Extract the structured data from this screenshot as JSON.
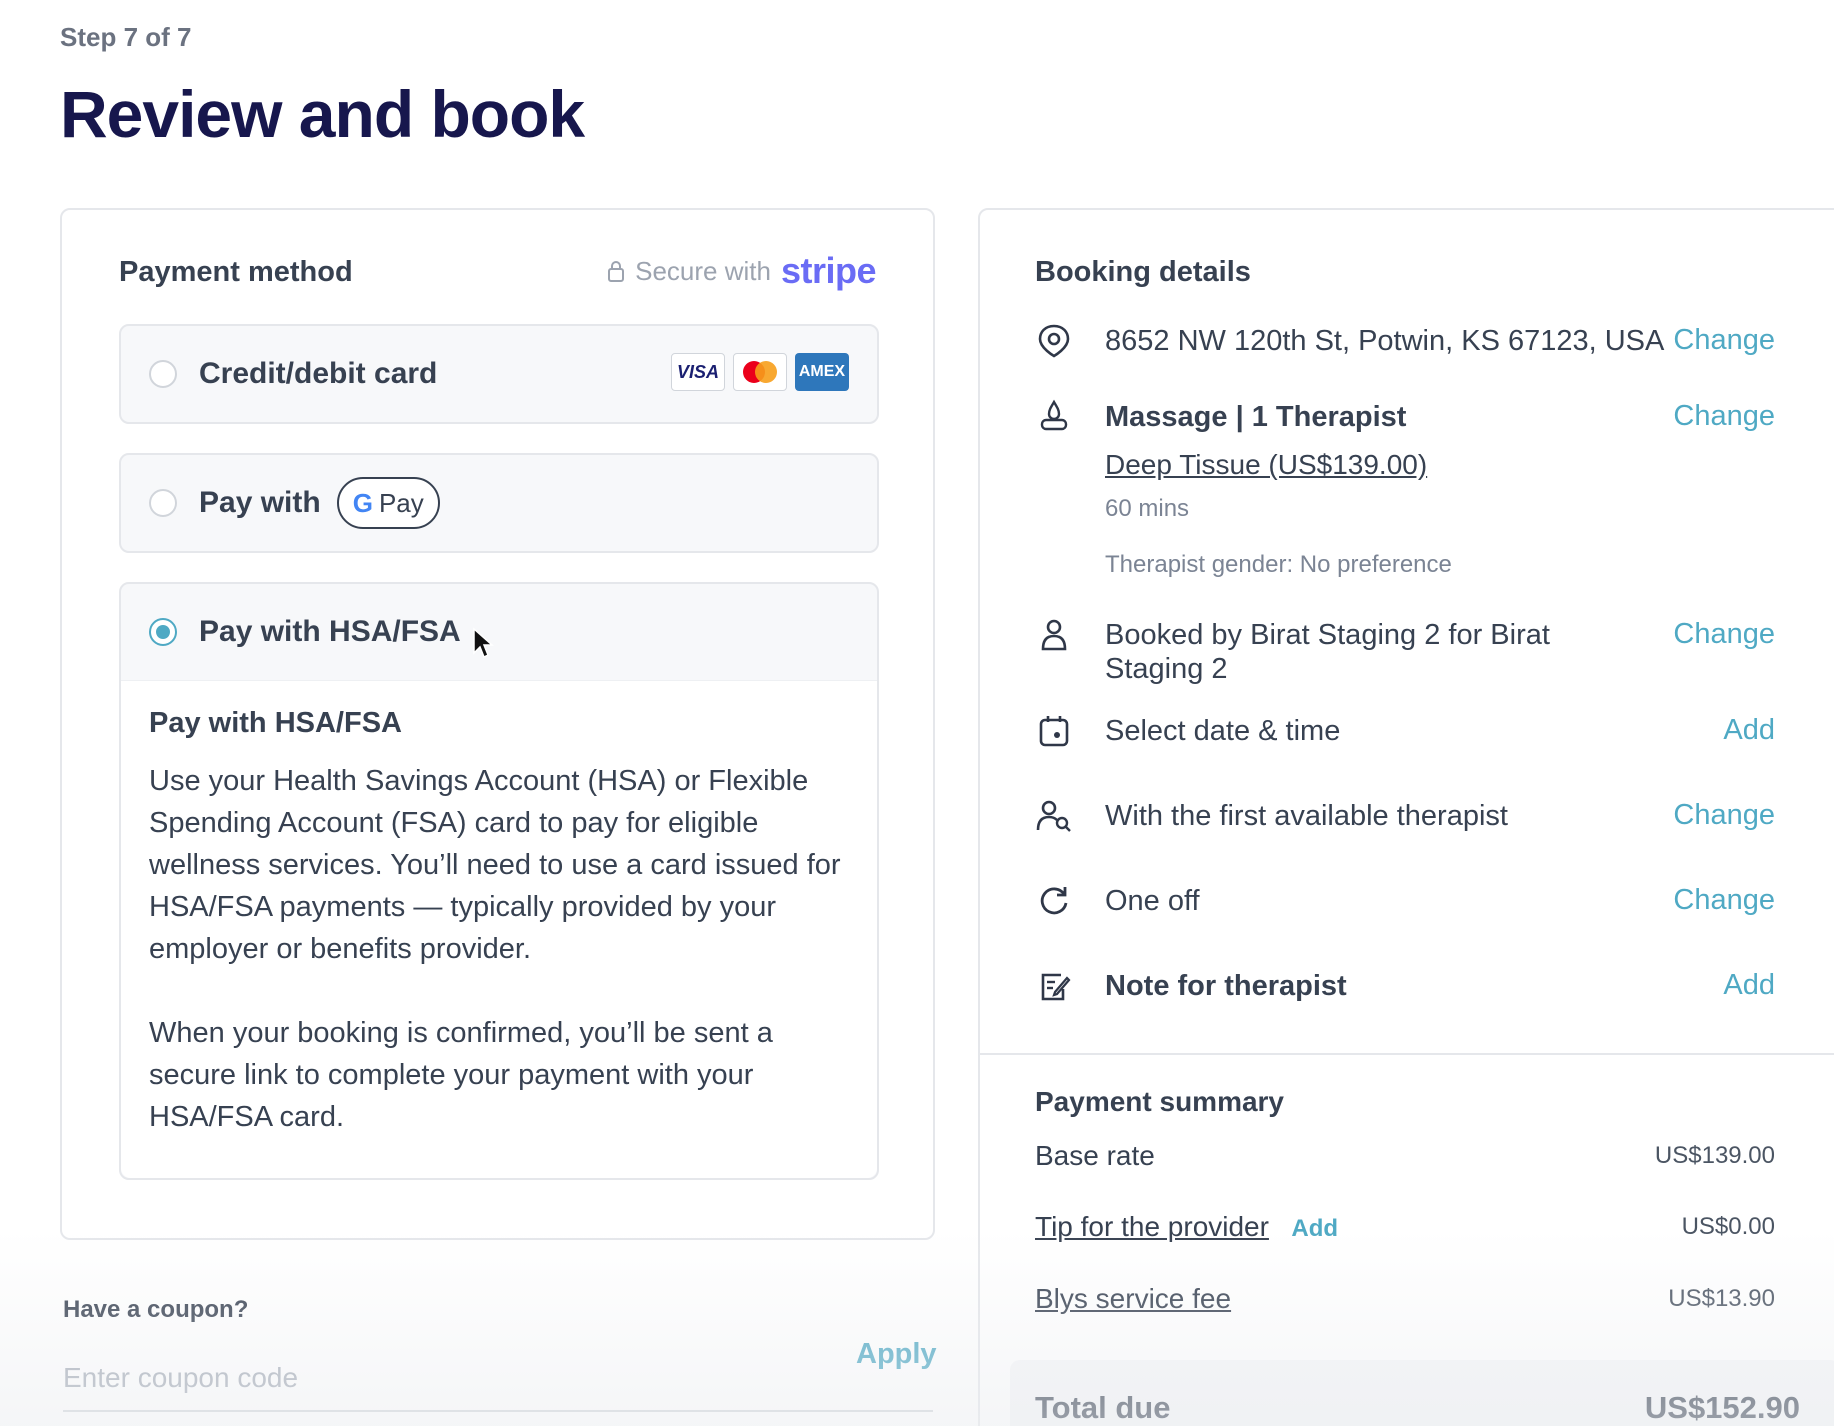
{
  "header": {
    "step": "Step 7 of 7",
    "title": "Review and book"
  },
  "payment": {
    "heading": "Payment method",
    "secure_label": "Secure with",
    "secure_brand": "stripe",
    "options": [
      {
        "label": "Credit/debit card",
        "selected": false,
        "cards": [
          "VISA",
          "Mastercard",
          "AMEX"
        ]
      },
      {
        "label": "Pay with",
        "badge": "Pay",
        "badge_g": "G",
        "selected": false
      },
      {
        "label": "Pay with HSA/FSA",
        "selected": true
      }
    ],
    "hsa": {
      "title": "Pay with HSA/FSA",
      "paragraph1": "Use your Health Savings Account (HSA) or Flexible Spending Account (FSA) card to pay for eligible wellness services. You’ll need to use a card issued for HSA/FSA payments — typically provided by your employer or benefits provider.",
      "paragraph2": "When your booking is confirmed, you’ll be sent a secure link to complete your payment with your HSA/FSA card."
    }
  },
  "coupon": {
    "label": "Have a coupon?",
    "placeholder": "Enter coupon code",
    "apply": "Apply"
  },
  "booking": {
    "heading": "Booking details",
    "address": "8652 NW 120th St, Potwin, KS 67123, USA",
    "service": "Massage | 1 Therapist",
    "treatment": "Deep Tissue (US$139.00)",
    "duration": "60 mins",
    "gender": "Therapist gender: No preference",
    "booked_by": "Booked by Birat Staging 2 for Birat Staging 2",
    "datetime": "Select date & time",
    "therapist": "With the first available therapist",
    "frequency": "One off",
    "note": "Note for therapist",
    "change": "Change",
    "add": "Add"
  },
  "summary": {
    "heading": "Payment summary",
    "base_label": "Base rate",
    "base_value": "US$139.00",
    "tip_label": "Tip for the provider",
    "tip_add": "Add",
    "tip_value": "US$0.00",
    "fee_label": "Blys service fee",
    "fee_value": "US$13.90",
    "total_label": "Total due",
    "total_value": "US$152.90"
  },
  "colors": {
    "accent": "#4fa9c4",
    "title": "#17174d",
    "stripe": "#6a6cf5"
  }
}
